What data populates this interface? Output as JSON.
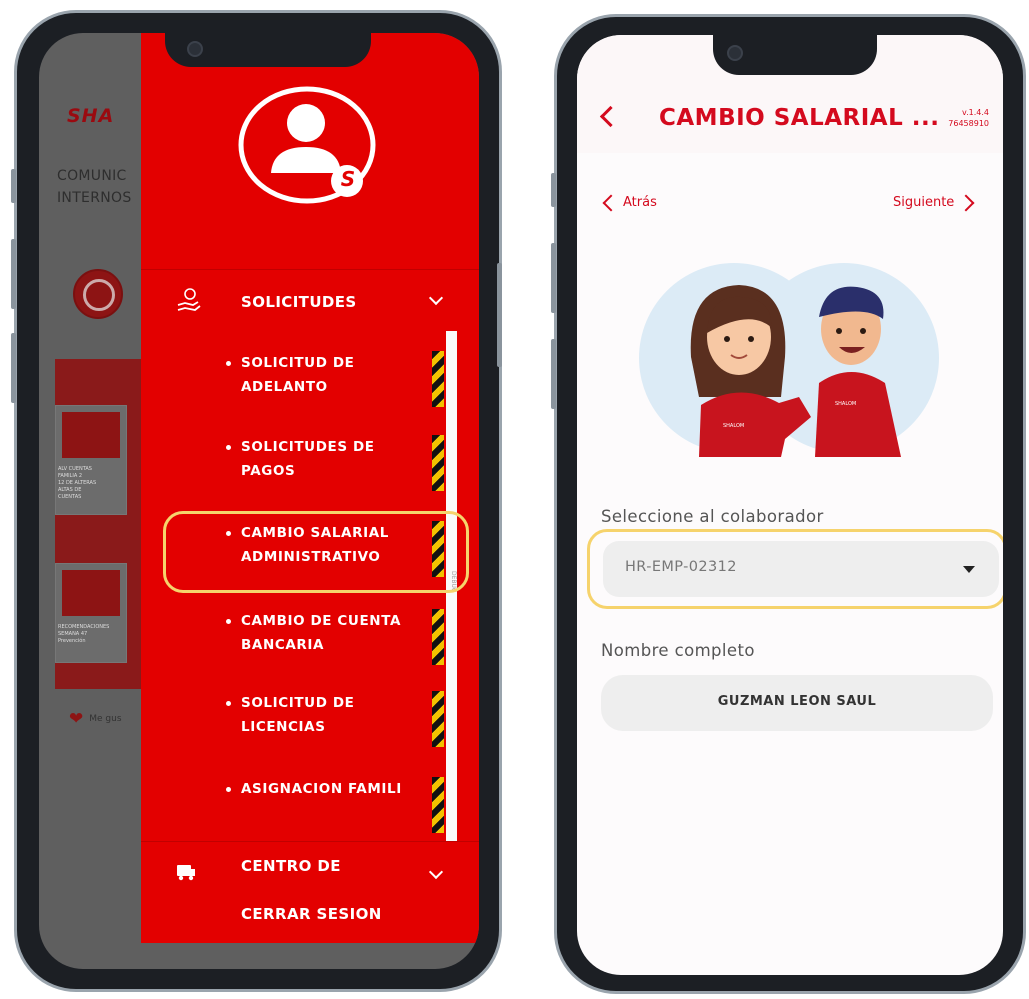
{
  "left_screen": {
    "background_app": {
      "logo_text": "SHA",
      "section_title_line1": "COMUNIC",
      "section_title_line2": "INTERNOS",
      "card_text_1": "ALV CUENTAS\nFAMILIA 2\n12 DE ALTERAS\nALTAS DE\nCUENTAS",
      "card_text_2": "RECOMENDACIONES\nSEMANA 47\nPrevención",
      "like_label": "Me gus"
    },
    "drawer": {
      "avatar_badge": "S",
      "sections": [
        {
          "label": "SOLICITUDES",
          "icon": "hand-coin-icon",
          "expanded": true
        },
        {
          "label": "CENTRO DE",
          "icon": "truck-icon",
          "expanded": false
        }
      ],
      "sub_items": [
        {
          "line1": "SOLICITUD DE",
          "line2": "ADELANTO"
        },
        {
          "line1": "SOLICITUDES DE",
          "line2": "PAGOS"
        },
        {
          "line1": "CAMBIO SALARIAL",
          "line2": "ADMINISTRATIVO"
        },
        {
          "line1": "CAMBIO DE CUENTA",
          "line2": "BANCARIA"
        },
        {
          "line1": "SOLICITUD DE",
          "line2": "LICENCIAS"
        },
        {
          "line1": "ASIGNACION FAMILI",
          "line2": ""
        }
      ],
      "logout_label": "CERRAR SESION",
      "badge_strip_text": "DEBUG"
    }
  },
  "right_screen": {
    "header": {
      "title": "CAMBIO SALARIAL ...",
      "version": "v.1.4.4",
      "build": "76458910"
    },
    "nav": {
      "back_label": "Atrás",
      "next_label": "Siguiente"
    },
    "form": {
      "collaborator_label": "Seleccione al colaborador",
      "collaborator_value": "HR-EMP-02312",
      "fullname_label": "Nombre completo",
      "fullname_value": "GUZMAN LEON SAUL"
    },
    "illustration_shirt_text": "SHALOM"
  },
  "colors": {
    "brand_red": "#e30000",
    "title_red": "#d40a1e",
    "highlight": "#f6d36c"
  }
}
